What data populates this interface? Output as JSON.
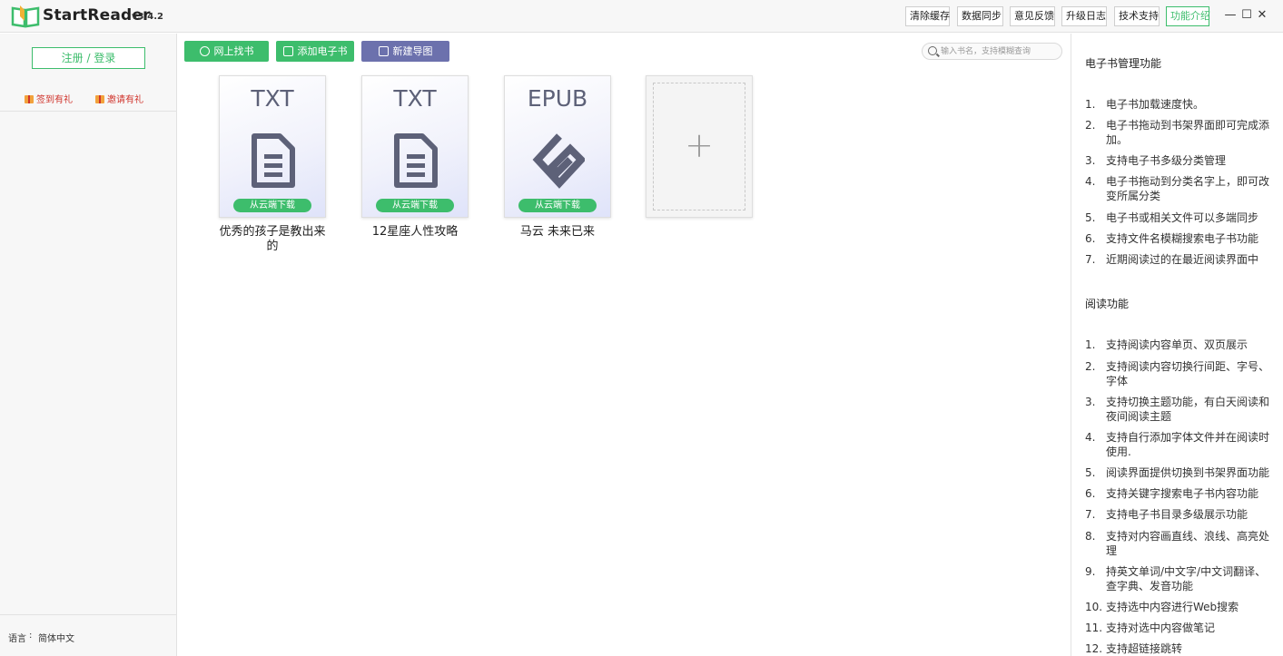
{
  "app": {
    "name": "StartReader",
    "version": "v3.4.2"
  },
  "titlebar": {
    "buttons": [
      {
        "label": "清除缓存"
      },
      {
        "label": "数据同步"
      },
      {
        "label": "意见反馈"
      },
      {
        "label": "升级日志"
      },
      {
        "label": "技术支持"
      },
      {
        "label": "功能介绍"
      }
    ],
    "window_controls": {
      "minimize": "—",
      "maximize": "☐",
      "close": "✕"
    }
  },
  "sidebar": {
    "login_label": "注册 / 登录",
    "signin_label": "签到有礼",
    "invite_label": "邀请有礼",
    "language_label": "语言",
    "language_separator": ":",
    "language_value": "简体中文"
  },
  "toolbar": {
    "find_books_label": "网上找书",
    "add_ebook_label": "添加电子书",
    "new_mindmap_label": "新建导图",
    "search_placeholder": "输入书名，支持模糊查询"
  },
  "books": [
    {
      "type": "TXT",
      "download_label": "从云端下载",
      "title": "优秀的孩子是教出来的"
    },
    {
      "type": "TXT",
      "download_label": "从云端下载",
      "title": "12星座人性攻略"
    },
    {
      "type": "EPUB",
      "download_label": "从云端下载",
      "title": "马云 未来已来"
    }
  ],
  "add_card": {
    "symbol": "+"
  },
  "features": {
    "ebook_title": "电子书管理功能",
    "ebook_items": [
      {
        "num": "1.",
        "text": "电子书加载速度快。"
      },
      {
        "num": "2.",
        "text": "电子书拖动到书架界面即可完成添加。"
      },
      {
        "num": "3.",
        "text": "支持电子书多级分类管理"
      },
      {
        "num": "4.",
        "text": "电子书拖动到分类名字上，即可改变所属分类"
      },
      {
        "num": "5.",
        "text": "电子书或相关文件可以多端同步"
      },
      {
        "num": "6.",
        "text": "支持文件名模糊搜索电子书功能"
      },
      {
        "num": "7.",
        "text": "近期阅读过的在最近阅读界面中"
      }
    ],
    "reading_title": "阅读功能",
    "reading_items": [
      {
        "num": "1.",
        "text": "支持阅读内容单页、双页展示"
      },
      {
        "num": "2.",
        "text": "支持阅读内容切换行间距、字号、字体"
      },
      {
        "num": "3.",
        "text": "支持切换主题功能，有白天阅读和夜间阅读主题"
      },
      {
        "num": "4.",
        "text": "支持自行添加字体文件并在阅读时使用."
      },
      {
        "num": "5.",
        "text": "阅读界面提供切换到书架界面功能"
      },
      {
        "num": "6.",
        "text": "支持关键字搜索电子书内容功能"
      },
      {
        "num": "7.",
        "text": "支持电子书目录多级展示功能"
      },
      {
        "num": "8.",
        "text": "支持对内容画直线、浪线、高亮处理"
      },
      {
        "num": "9.",
        "text": "持英文单词/中文字/中文词翻译、查字典、发音功能"
      },
      {
        "num": "10.",
        "text": "支持选中内容进行Web搜索"
      },
      {
        "num": "11.",
        "text": "支持对选中内容做笔记"
      },
      {
        "num": "12.",
        "text": "支持超链接跳转"
      }
    ]
  },
  "colors": {
    "accent": "#3dbd6c",
    "purple": "#6c71ad",
    "link_red": "#d0342c"
  }
}
